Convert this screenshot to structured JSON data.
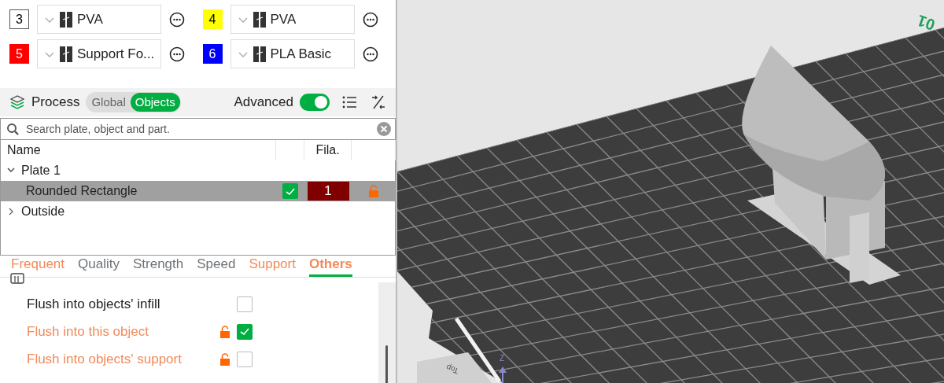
{
  "filaments": [
    {
      "index": "3",
      "color": "#ffffff",
      "name": "PVA"
    },
    {
      "index": "4",
      "color": "#ffff00",
      "name": "PVA"
    },
    {
      "index": "5",
      "color": "#ff0000",
      "name": "Support Fo..."
    },
    {
      "index": "6",
      "color": "#0000ff",
      "name": "PLA Basic"
    }
  ],
  "process": {
    "title": "Process",
    "modes": [
      {
        "label": "Global",
        "selected": false
      },
      {
        "label": "Objects",
        "selected": true
      }
    ],
    "advanced": {
      "label": "Advanced",
      "on": true
    }
  },
  "search": {
    "placeholder": "Search plate, object and part."
  },
  "tree": {
    "columns": {
      "name": "Name",
      "filament": "Fila."
    },
    "nodes": [
      {
        "label": "Plate 1",
        "expanded": true,
        "children": [
          {
            "label": "Rounded Rectangle",
            "selected": true,
            "checked": true,
            "filament": "1",
            "color": "#800000",
            "locked": false
          }
        ]
      },
      {
        "label": "Outside",
        "expanded": false
      }
    ]
  },
  "tabs": [
    {
      "label": "Frequent",
      "selected": false,
      "modified": true
    },
    {
      "label": "Quality",
      "selected": false,
      "modified": false
    },
    {
      "label": "Strength",
      "selected": false,
      "modified": false
    },
    {
      "label": "Speed",
      "selected": false,
      "modified": false
    },
    {
      "label": "Support",
      "selected": false,
      "modified": true
    },
    {
      "label": "Others",
      "selected": true,
      "modified": true
    }
  ],
  "options": [
    {
      "label": "Flush into objects' infill",
      "checked": false,
      "modified": false
    },
    {
      "label": "Flush into this object",
      "checked": true,
      "modified": true
    },
    {
      "label": "Flush into objects' support",
      "checked": false,
      "modified": true
    }
  ],
  "viewport": {
    "plate_label": "01",
    "view_cube": "Top",
    "axis": "Z"
  }
}
